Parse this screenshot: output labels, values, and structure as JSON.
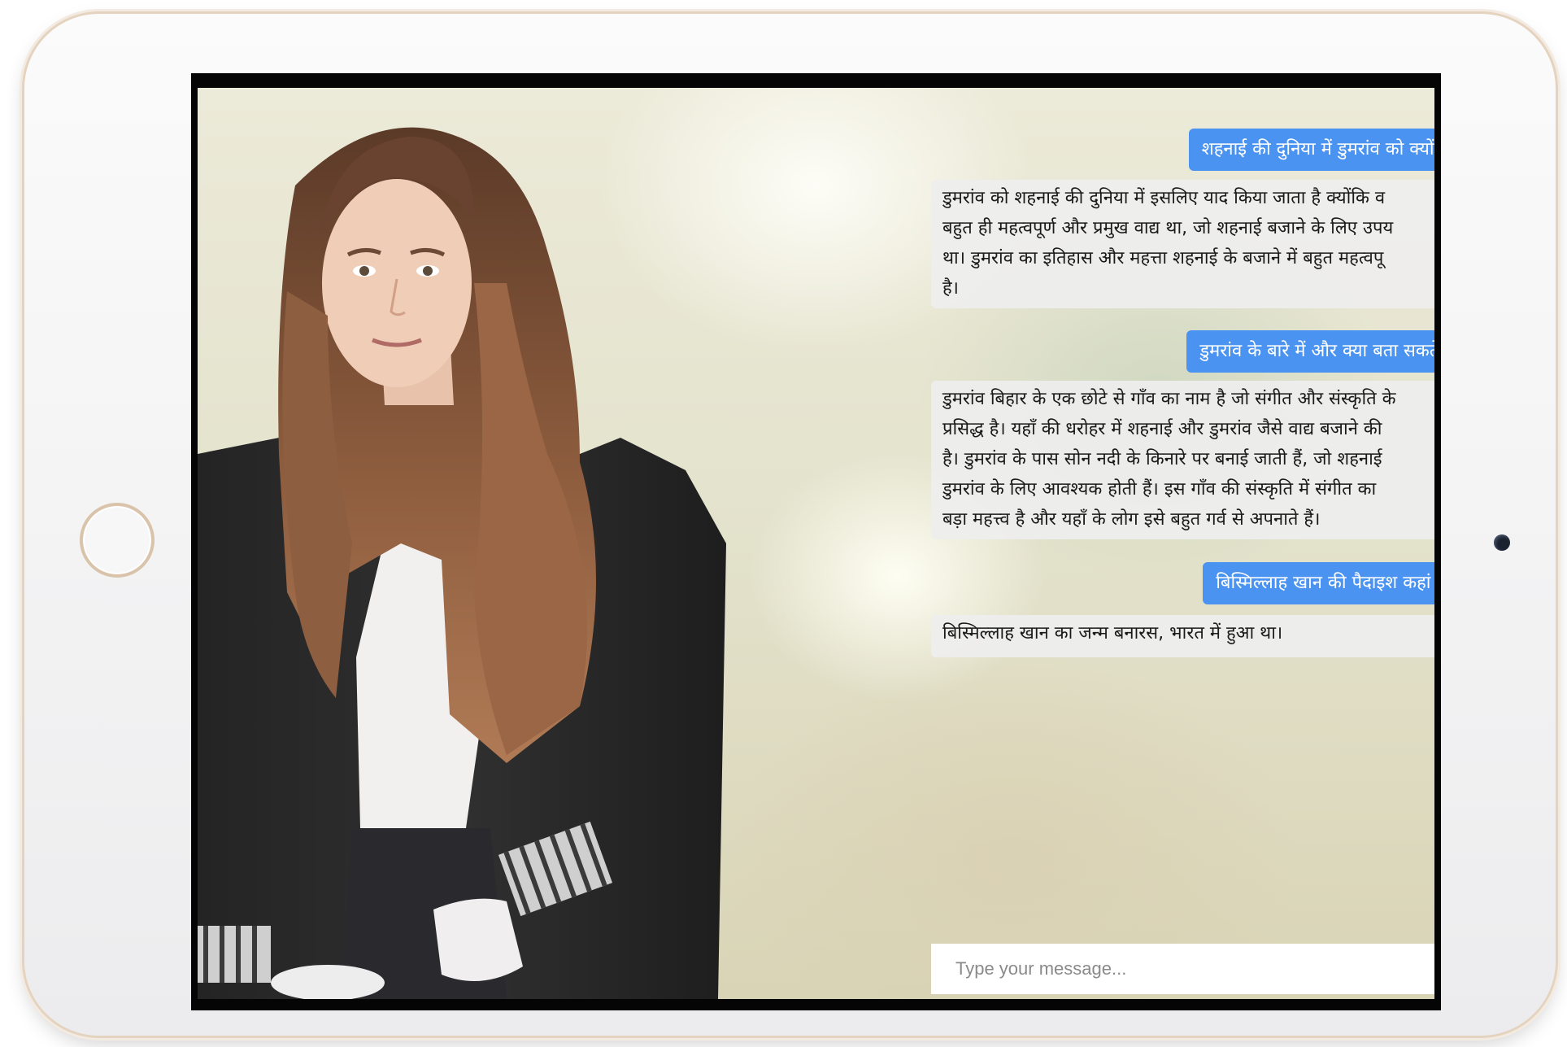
{
  "chat": {
    "messages": [
      {
        "role": "user",
        "text": "शहनाई की दुनिया में डुमरांव को क्यों या"
      },
      {
        "role": "bot",
        "lines": [
          "डुमरांव को शहनाई की दुनिया में इसलिए याद किया जाता है क्योंकि व",
          "बहुत ही महत्वपूर्ण और प्रमुख वाद्य था, जो शहनाई बजाने के लिए उपय",
          "था। डुमरांव का इतिहास और महत्ता शहनाई के बजाने में बहुत महत्वपू",
          "है।"
        ]
      },
      {
        "role": "user",
        "text": "डुमरांव के बारे में और क्या बता सकते हैं"
      },
      {
        "role": "bot",
        "lines": [
          "डुमरांव बिहार के एक छोटे से गाँव का नाम है जो संगीत और संस्कृति के",
          "प्रसिद्ध है। यहाँ की धरोहर में शहनाई और डुमरांव जैसे वाद्य बजाने की",
          "है। डुमरांव के पास सोन नदी के किनारे पर बनाई जाती हैं, जो शहनाई",
          "डुमरांव के लिए आवश्यक होती हैं। इस गाँव की संस्कृति में संगीत का",
          "बड़ा महत्त्व है और यहाँ के लोग इसे बहुत गर्व से अपनाते हैं।"
        ]
      },
      {
        "role": "user",
        "text": "बिस्मिल्लाह खान की पैदाइश कहां हुई"
      },
      {
        "role": "bot",
        "lines": [
          "बिस्मिल्लाह खान का जन्म बनारस, भारत में हुआ था।"
        ]
      }
    ],
    "input": {
      "placeholder": "Type your message...",
      "value": ""
    }
  },
  "colors": {
    "user_bubble": "#4b93f0",
    "bot_bubble": "#eeeeee",
    "device_trim": "#d9c3aa"
  },
  "icons": {
    "home_button": "home-button-icon",
    "camera": "front-camera-icon"
  }
}
